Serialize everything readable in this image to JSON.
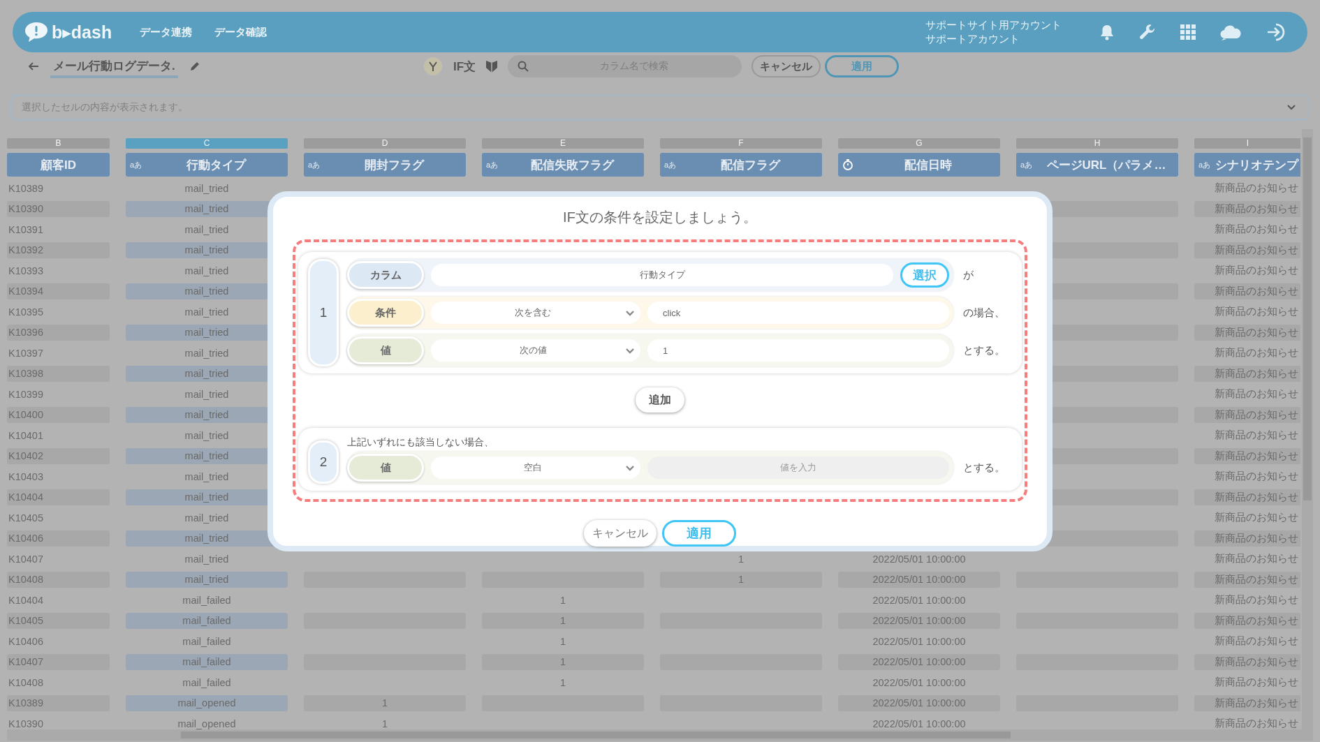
{
  "app": {
    "logo": "b▸dash",
    "nav": [
      {
        "label": "データ連携"
      },
      {
        "label": "データ確認"
      }
    ],
    "account": {
      "site": "サポートサイト用アカウント",
      "user": "サポートアカウント"
    }
  },
  "toolbar": {
    "title": "メール行動ログデータ.",
    "mode_label": "IF文",
    "search": {
      "placeholder": "カラム名で検索"
    },
    "buttons": [
      {
        "label": "キャンセル",
        "kind": "secondary"
      },
      {
        "label": "適用",
        "kind": "primary"
      }
    ]
  },
  "cell_preview": {
    "placeholder": "選択したセルの内容が表示されます。"
  },
  "table": {
    "columns": [
      {
        "letter": "B",
        "name": "顧客ID",
        "kind": "none",
        "selected": false
      },
      {
        "letter": "C",
        "name": "行動タイプ",
        "kind": "text",
        "type_mark": "aあ",
        "selected": true
      },
      {
        "letter": "D",
        "name": "開封フラグ",
        "kind": "text",
        "type_mark": "aあ",
        "selected": false
      },
      {
        "letter": "E",
        "name": "配信失敗フラグ",
        "kind": "text",
        "type_mark": "aあ",
        "selected": false
      },
      {
        "letter": "F",
        "name": "配信フラグ",
        "kind": "text",
        "type_mark": "aあ",
        "selected": false
      },
      {
        "letter": "G",
        "name": "配信日時",
        "kind": "datetime",
        "selected": false
      },
      {
        "letter": "H",
        "name": "ページURL（パラメ…",
        "kind": "text",
        "type_mark": "aあ",
        "selected": false
      },
      {
        "letter": "I",
        "name": "シナリオテンプ",
        "kind": "text",
        "type_mark": "aあ",
        "selected": false
      }
    ],
    "rows": [
      [
        "K10389",
        "mail_tried",
        null,
        null,
        null,
        null,
        null,
        "新商品のお知らせ"
      ],
      [
        "K10390",
        "mail_tried",
        null,
        null,
        null,
        null,
        null,
        "新商品のお知らせ"
      ],
      [
        "K10391",
        "mail_tried",
        null,
        null,
        null,
        null,
        null,
        "新商品のお知らせ"
      ],
      [
        "K10392",
        "mail_tried",
        null,
        null,
        null,
        null,
        null,
        "新商品のお知らせ"
      ],
      [
        "K10393",
        "mail_tried",
        null,
        null,
        null,
        null,
        null,
        "新商品のお知らせ"
      ],
      [
        "K10394",
        "mail_tried",
        null,
        null,
        null,
        null,
        null,
        "新商品のお知らせ"
      ],
      [
        "K10395",
        "mail_tried",
        null,
        null,
        null,
        null,
        null,
        "新商品のお知らせ"
      ],
      [
        "K10396",
        "mail_tried",
        null,
        null,
        null,
        null,
        null,
        "新商品のお知らせ"
      ],
      [
        "K10397",
        "mail_tried",
        null,
        null,
        null,
        null,
        null,
        "新商品のお知らせ"
      ],
      [
        "K10398",
        "mail_tried",
        null,
        null,
        null,
        null,
        null,
        "新商品のお知らせ"
      ],
      [
        "K10399",
        "mail_tried",
        null,
        null,
        null,
        null,
        null,
        "新商品のお知らせ"
      ],
      [
        "K10400",
        "mail_tried",
        null,
        null,
        null,
        null,
        null,
        "新商品のお知らせ"
      ],
      [
        "K10401",
        "mail_tried",
        null,
        null,
        null,
        null,
        null,
        "新商品のお知らせ"
      ],
      [
        "K10402",
        "mail_tried",
        null,
        null,
        null,
        null,
        null,
        "新商品のお知らせ"
      ],
      [
        "K10403",
        "mail_tried",
        null,
        null,
        null,
        null,
        null,
        "新商品のお知らせ"
      ],
      [
        "K10404",
        "mail_tried",
        null,
        null,
        null,
        null,
        null,
        "新商品のお知らせ"
      ],
      [
        "K10405",
        "mail_tried",
        null,
        null,
        null,
        null,
        null,
        "新商品のお知らせ"
      ],
      [
        "K10406",
        "mail_tried",
        null,
        null,
        null,
        null,
        null,
        "新商品のお知らせ"
      ],
      [
        "K10407",
        "mail_tried",
        null,
        null,
        "1",
        "2022/05/01 10:00:00",
        null,
        "新商品のお知らせ"
      ],
      [
        "K10408",
        "mail_tried",
        null,
        null,
        "1",
        "2022/05/01 10:00:00",
        null,
        "新商品のお知らせ"
      ],
      [
        "K10404",
        "mail_failed",
        null,
        "1",
        null,
        "2022/05/01 10:00:00",
        null,
        "新商品のお知らせ"
      ],
      [
        "K10405",
        "mail_failed",
        null,
        "1",
        null,
        "2022/05/01 10:00:00",
        null,
        "新商品のお知らせ"
      ],
      [
        "K10406",
        "mail_failed",
        null,
        "1",
        null,
        "2022/05/01 10:00:00",
        null,
        "新商品のお知らせ"
      ],
      [
        "K10407",
        "mail_failed",
        null,
        "1",
        null,
        "2022/05/01 10:00:00",
        null,
        "新商品のお知らせ"
      ],
      [
        "K10408",
        "mail_failed",
        null,
        "1",
        null,
        "2022/05/01 10:00:00",
        null,
        "新商品のお知らせ"
      ],
      [
        "K10389",
        "mail_opened",
        "1",
        null,
        null,
        "2022/05/01 10:00:00",
        null,
        "新商品のお知らせ"
      ],
      [
        "K10390",
        "mail_opened",
        "1",
        null,
        null,
        "2022/05/01 10:00:00",
        null,
        "新商品のお知らせ"
      ]
    ]
  },
  "dialog": {
    "title": "IF文の条件を設定しましょう。",
    "rules": [
      {
        "number": "1",
        "rows": [
          {
            "kind": "column",
            "label": "カラム",
            "value": "行動タイプ",
            "button": "選択",
            "suffix": "が"
          },
          {
            "kind": "condition",
            "label": "条件",
            "select": "次を含む",
            "value": "click",
            "suffix": "の場合、"
          },
          {
            "kind": "value",
            "label": "値",
            "select": "次の値",
            "value": "1",
            "suffix": "とする。"
          }
        ]
      }
    ],
    "add_button": "追加",
    "fallback": {
      "number": "2",
      "note": "上記いずれにも該当しない場合、",
      "rows": [
        {
          "kind": "value",
          "label": "値",
          "select": "空白",
          "placeholder": "値を入力",
          "disabled": true,
          "suffix": "とする。"
        }
      ]
    },
    "buttons": [
      {
        "label": "キャンセル",
        "kind": "secondary"
      },
      {
        "label": "適用",
        "kind": "primary"
      }
    ]
  }
}
